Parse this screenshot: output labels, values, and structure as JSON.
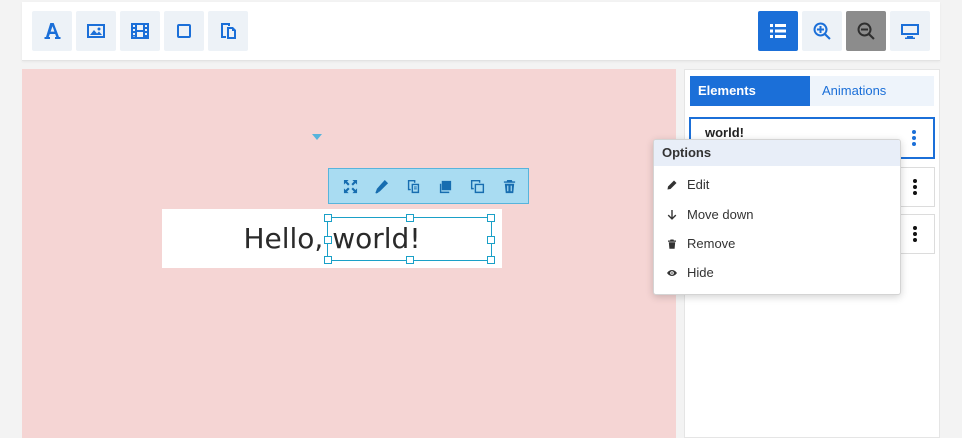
{
  "toolbar": {
    "left_tools": [
      {
        "name": "text-tool-button",
        "icon": "text-icon"
      },
      {
        "name": "image-tool-button",
        "icon": "image-icon"
      },
      {
        "name": "video-tool-button",
        "icon": "film-icon"
      },
      {
        "name": "shape-tool-button",
        "icon": "square-icon"
      },
      {
        "name": "paste-tool-button",
        "icon": "paste-icon"
      }
    ],
    "right_tools": [
      {
        "name": "list-view-button",
        "icon": "list-icon",
        "state": "active"
      },
      {
        "name": "zoom-in-button",
        "icon": "zoom-in-icon",
        "state": "normal"
      },
      {
        "name": "zoom-out-button",
        "icon": "zoom-out-icon",
        "state": "disabled"
      },
      {
        "name": "preview-button",
        "icon": "monitor-icon",
        "state": "normal"
      }
    ]
  },
  "canvas": {
    "text": "Hello, world!",
    "background": "#f5d5d4",
    "floating_toolbar": [
      "expand-icon",
      "edit-icon",
      "duplicate-icon",
      "bring-front-icon",
      "copy-icon",
      "trash-icon"
    ]
  },
  "panel": {
    "tabs": [
      {
        "label": "Elements",
        "active": true
      },
      {
        "label": "Animations",
        "active": false
      }
    ],
    "elements": [
      {
        "label": "world!",
        "selected": true
      },
      {
        "label": "",
        "selected": false
      },
      {
        "label": "",
        "selected": false
      }
    ]
  },
  "context_menu": {
    "title": "Options",
    "items": [
      {
        "label": "Edit",
        "icon": "pencil-icon"
      },
      {
        "label": "Move down",
        "icon": "arrow-down-icon"
      },
      {
        "label": "Remove",
        "icon": "trash-icon"
      },
      {
        "label": "Hide",
        "icon": "eye-icon"
      }
    ]
  },
  "colors": {
    "accent": "#1b6fd8",
    "selection": "#1aa0c7"
  }
}
